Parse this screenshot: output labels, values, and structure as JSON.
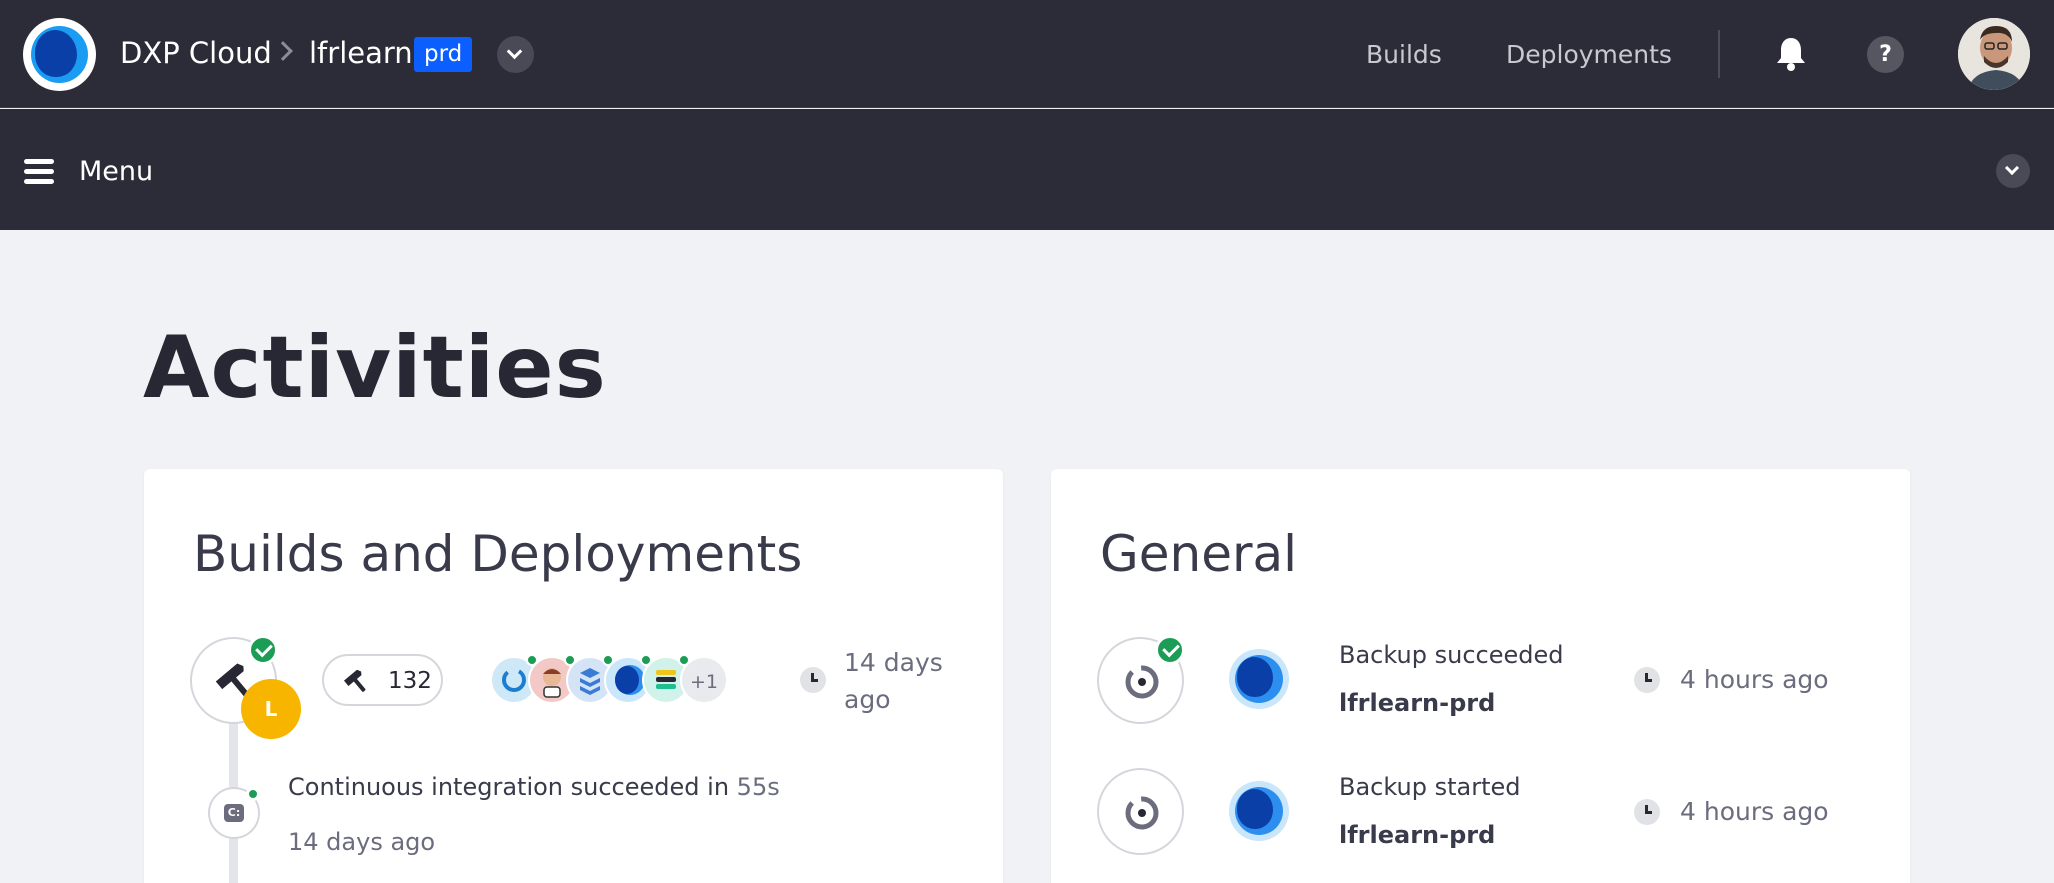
{
  "topbar": {
    "brand": "DXP Cloud",
    "project": "lfrlearn",
    "env_badge": "prd",
    "nav": {
      "builds": "Builds",
      "deployments": "Deployments"
    },
    "help": "?"
  },
  "menubar": {
    "label": "Menu"
  },
  "page": {
    "title": "Activities"
  },
  "builds_card": {
    "title": "Builds and Deployments",
    "build": {
      "user_initial": "L",
      "build_number": "132",
      "services": [
        "sync-icon",
        "jenkins-icon",
        "database-icon",
        "liferay-icon",
        "search-icon"
      ],
      "more_count": "+1",
      "time": "14 days\nago"
    },
    "ci": {
      "text": "Continuous integration succeeded in",
      "duration": "55s",
      "time": "14 days ago"
    }
  },
  "general_card": {
    "title": "General",
    "items": [
      {
        "title": "Backup succeeded",
        "service": "lfrlearn-prd",
        "time": "4 hours ago"
      },
      {
        "title": "Backup started",
        "service": "lfrlearn-prd",
        "time": "4 hours ago"
      }
    ]
  },
  "colors": {
    "topbar_bg": "#2b2c38",
    "env_badge": "#0b5fff",
    "success": "#1c9d55",
    "user_badge": "#f7b500"
  }
}
